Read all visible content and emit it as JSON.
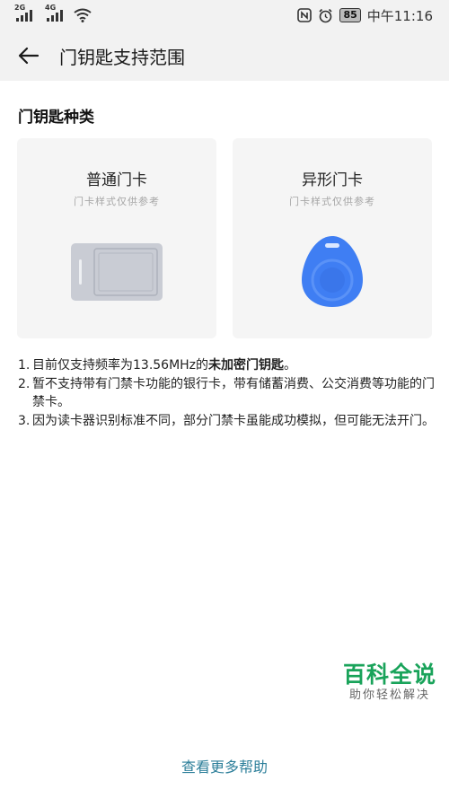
{
  "status_bar": {
    "signal1_tag": "2G",
    "signal2_tag": "4G",
    "battery": "85",
    "time": "中午11:16"
  },
  "app_bar": {
    "title": "门钥匙支持范围"
  },
  "section": {
    "title": "门钥匙种类"
  },
  "cards": [
    {
      "title": "普通门卡",
      "subtitle": "门卡样式仅供参考"
    },
    {
      "title": "异形门卡",
      "subtitle": "门卡样式仅供参考"
    }
  ],
  "notes": [
    {
      "num": "1.",
      "text": "目前仅支持频率为13.56MHz的",
      "bold": "未加密门钥匙",
      "tail": "。"
    },
    {
      "num": "2.",
      "text": "暂不支持带有门禁卡功能的银行卡，带有储蓄消费、公交消费等功能的门禁卡。"
    },
    {
      "num": "3.",
      "text": "因为读卡器识别标准不同，部分门禁卡虽能成功模拟，但可能无法开门。"
    }
  ],
  "help_link": "查看更多帮助",
  "watermark": {
    "main": "百科全说",
    "sub": "助你轻松解决"
  },
  "colors": {
    "accent_link": "#2d7f9a",
    "fob_blue": "#3f7ef3",
    "watermark_green": "#19a35a"
  }
}
